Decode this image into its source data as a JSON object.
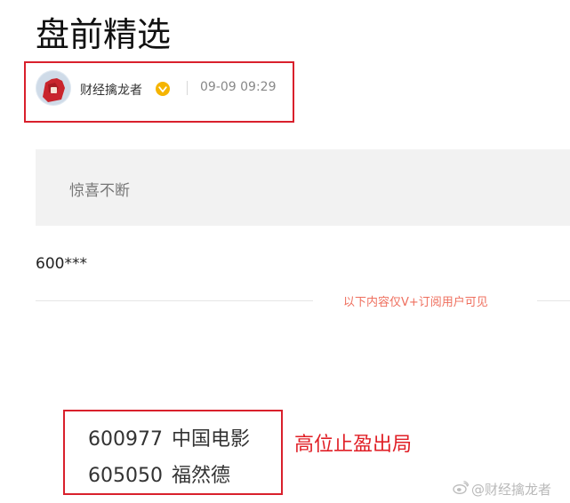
{
  "page": {
    "title": "盘前精选"
  },
  "author": {
    "name": "财经擒龙者",
    "time": "09-09 09:29",
    "verified_icon": "verified-badge-icon",
    "verified_color": "#f5b400"
  },
  "content": {
    "intro": "惊喜不断",
    "code_teaser": "600***",
    "paywall_notice": "以下内容仅V+订阅用户可见",
    "stocks": [
      {
        "code": "600977",
        "name": "中国电影"
      },
      {
        "code": "605050",
        "name": "福然德"
      }
    ],
    "annotation": "高位止盈出局"
  },
  "watermark": {
    "text": "@财经擒龙者",
    "icon": "weibo-icon"
  },
  "colors": {
    "highlight_border": "#d9202c",
    "annotation": "#e01f26",
    "paywall": "#ef6f5e"
  }
}
